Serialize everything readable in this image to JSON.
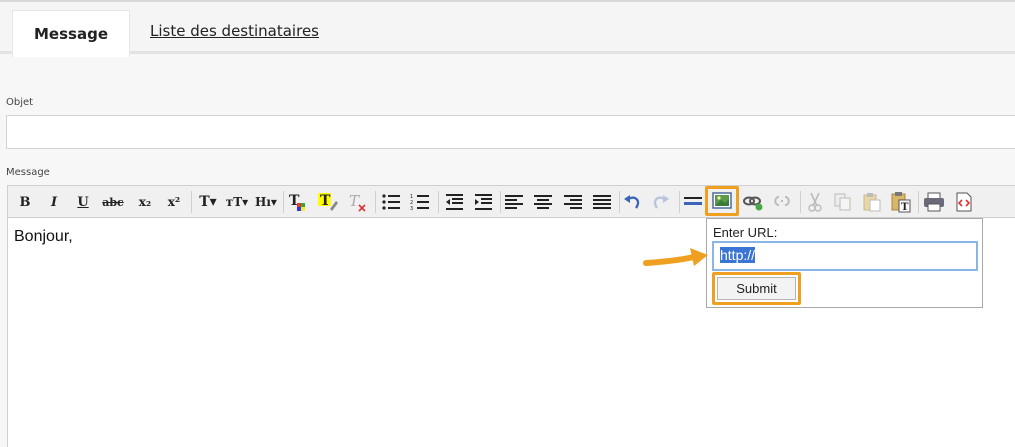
{
  "tabs": {
    "active": "Message",
    "other": "Liste des destinataires"
  },
  "form": {
    "objet_label": "Objet",
    "objet_value": "",
    "message_label": "Message"
  },
  "editor": {
    "content": "Bonjour,"
  },
  "toolbar": {
    "icons": [
      "bold-icon",
      "italic-icon",
      "underline-icon",
      "strikethrough-icon",
      "subscript-icon",
      "superscript-icon",
      "font-size-icon",
      "font-family-icon",
      "heading-icon",
      "text-color-icon",
      "highlight-color-icon",
      "clear-format-icon",
      "bullet-list-icon",
      "numbered-list-icon",
      "outdent-icon",
      "indent-icon",
      "align-left-icon",
      "align-center-icon",
      "align-right-icon",
      "justify-icon",
      "undo-icon",
      "redo-icon",
      "horizontal-rule-icon",
      "insert-image-icon",
      "insert-link-icon",
      "unlink-icon",
      "cut-icon",
      "copy-icon",
      "paste-icon",
      "paste-text-icon",
      "print-icon",
      "source-code-icon"
    ],
    "glyphs": {
      "bold": "B",
      "italic": "I",
      "underline": "U",
      "strike": "abc",
      "sub": "x₂",
      "sup": "x²",
      "size": "T▾",
      "family": "тT▾",
      "heading": "Hı▾"
    }
  },
  "popup": {
    "label": "Enter URL:",
    "value": "http://",
    "submit": "Submit"
  },
  "colors": {
    "highlight": "#f0a020",
    "selection": "#3a75d4",
    "input_focus": "#8ab6e6"
  }
}
